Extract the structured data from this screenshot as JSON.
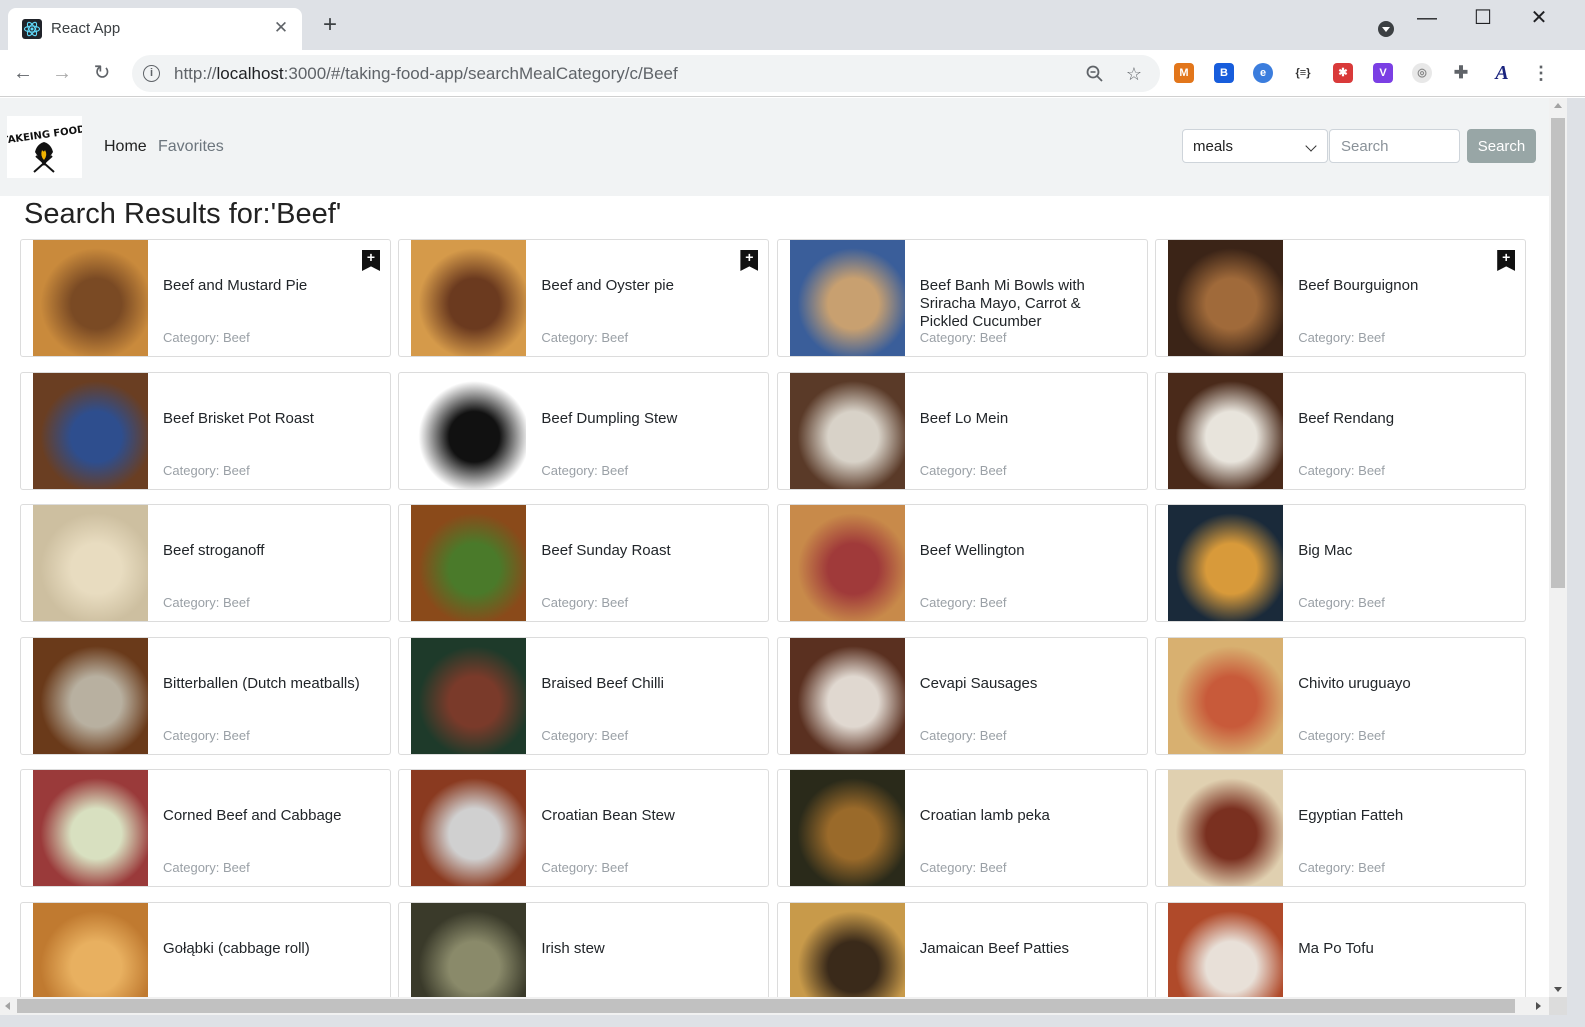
{
  "browser": {
    "tab_title": "React App",
    "tab_favicon": "react-icon",
    "new_tab_symbol": "+",
    "url_prefix": "http://",
    "url_host": "localhost",
    "url_rest": ":3000/#/taking-food-app/searchMealCategory/c/Beef",
    "window_controls": [
      "minimize",
      "maximize",
      "close"
    ]
  },
  "navbar": {
    "logo_text": "TAKEING FOOD",
    "links": {
      "home": "Home",
      "favorites": "Favorites"
    },
    "search_type": "meals",
    "search_placeholder": "Search",
    "search_button": "Search"
  },
  "results": {
    "title": "Search Results for:'Beef'",
    "meals": [
      {
        "name": "Beef and Mustard Pie",
        "category": "Category: Beef",
        "bookmarked": true,
        "img": [
          "#c98a3c",
          "#7a4a24"
        ]
      },
      {
        "name": "Beef and Oyster pie",
        "category": "Category: Beef",
        "bookmarked": true,
        "img": [
          "#d59a4a",
          "#6b3a1f"
        ]
      },
      {
        "name": "Beef Banh Mi Bowls with Sriracha Mayo, Carrot & Pickled Cucumber",
        "category": "Category: Beef",
        "bookmarked": false,
        "img": [
          "#3a5e9a",
          "#c8a070"
        ]
      },
      {
        "name": "Beef Bourguignon",
        "category": "Category: Beef",
        "bookmarked": true,
        "img": [
          "#3b2417",
          "#a06a3a"
        ]
      },
      {
        "name": "Beef Brisket Pot Roast",
        "category": "Category: Beef",
        "bookmarked": false,
        "img": [
          "#6a3e22",
          "#2e4e8e"
        ]
      },
      {
        "name": "Beef Dumpling Stew",
        "category": "Category: Beef",
        "bookmarked": false,
        "img": [
          "#ffffff",
          "#111111"
        ]
      },
      {
        "name": "Beef Lo Mein",
        "category": "Category: Beef",
        "bookmarked": false,
        "img": [
          "#5a3a28",
          "#d8d2c8"
        ]
      },
      {
        "name": "Beef Rendang",
        "category": "Category: Beef",
        "bookmarked": false,
        "img": [
          "#4a2a1a",
          "#e8e4dc"
        ]
      },
      {
        "name": "Beef stroganoff",
        "category": "Category: Beef",
        "bookmarked": false,
        "img": [
          "#cdbfa0",
          "#e8dcc0"
        ]
      },
      {
        "name": "Beef Sunday Roast",
        "category": "Category: Beef",
        "bookmarked": false,
        "img": [
          "#8a4a1a",
          "#4a7a2a"
        ]
      },
      {
        "name": "Beef Wellington",
        "category": "Category: Beef",
        "bookmarked": false,
        "img": [
          "#c88a4a",
          "#a03a3a"
        ]
      },
      {
        "name": "Big Mac",
        "category": "Category: Beef",
        "bookmarked": false,
        "img": [
          "#1a2a3a",
          "#d89a3a"
        ]
      },
      {
        "name": "Bitterballen (Dutch meatballs)",
        "category": "Category: Beef",
        "bookmarked": false,
        "img": [
          "#6a3a1a",
          "#b8b0a0"
        ]
      },
      {
        "name": "Braised Beef Chilli",
        "category": "Category: Beef",
        "bookmarked": false,
        "img": [
          "#1e3a2a",
          "#7a3a2a"
        ]
      },
      {
        "name": "Cevapi Sausages",
        "category": "Category: Beef",
        "bookmarked": false,
        "img": [
          "#5a3020",
          "#e0d8d0"
        ]
      },
      {
        "name": "Chivito uruguayo",
        "category": "Category: Beef",
        "bookmarked": false,
        "img": [
          "#d8b070",
          "#c85a3a"
        ]
      },
      {
        "name": "Corned Beef and Cabbage",
        "category": "Category: Beef",
        "bookmarked": false,
        "img": [
          "#9a3a3a",
          "#d8e0c0"
        ]
      },
      {
        "name": "Croatian Bean Stew",
        "category": "Category: Beef",
        "bookmarked": false,
        "img": [
          "#8a3a20",
          "#d0d0d0"
        ]
      },
      {
        "name": "Croatian lamb peka",
        "category": "Category: Beef",
        "bookmarked": false,
        "img": [
          "#2a2a1a",
          "#9a6a2a"
        ]
      },
      {
        "name": "Egyptian Fatteh",
        "category": "Category: Beef",
        "bookmarked": false,
        "img": [
          "#e0d0b0",
          "#7a3020"
        ]
      },
      {
        "name": "Gołąbki (cabbage roll)",
        "category": "",
        "bookmarked": false,
        "img": [
          "#c07a30",
          "#e8b060"
        ]
      },
      {
        "name": "Irish stew",
        "category": "",
        "bookmarked": false,
        "img": [
          "#3a3a2a",
          "#8a8a6a"
        ]
      },
      {
        "name": "Jamaican Beef Patties",
        "category": "",
        "bookmarked": false,
        "img": [
          "#c89a4a",
          "#3a2a1a"
        ]
      },
      {
        "name": "Ma Po Tofu",
        "category": "",
        "bookmarked": false,
        "img": [
          "#b04a2a",
          "#e8e0d8"
        ]
      }
    ]
  }
}
